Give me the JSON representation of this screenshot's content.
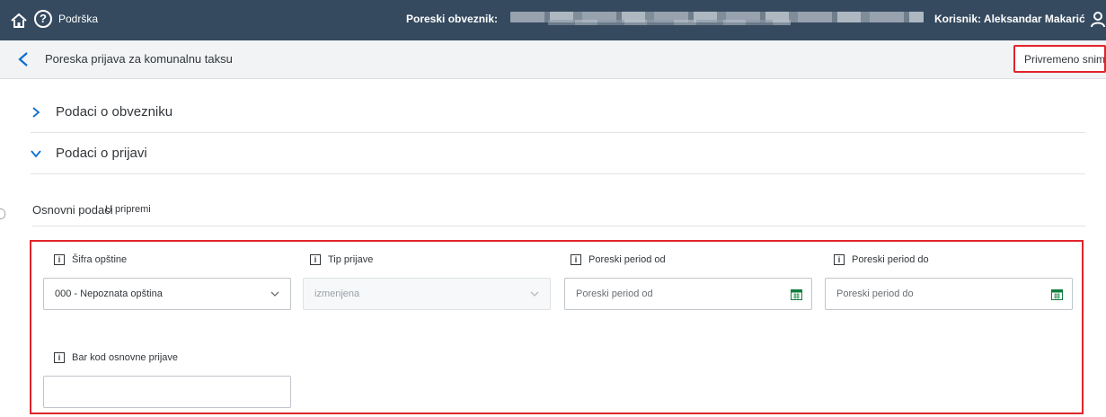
{
  "shell": {
    "support_label": "Podrška",
    "taxpayer_label": "Poreski obveznik:",
    "user_label": "Korisnik: Aleksandar Makarić",
    "icons": [
      "home-icon",
      "help-icon",
      "user-icon"
    ]
  },
  "header": {
    "title": "Poreska prijava za komunalnu taksu",
    "save_draft_label": "Privremeno snimi"
  },
  "sections": [
    {
      "label": "Podaci o obvezniku",
      "expanded": false
    },
    {
      "label": "Podaci o prijavi",
      "expanded": true
    }
  ],
  "basic": {
    "title": "Osnovni podaci",
    "status": "U pripremi"
  },
  "form": {
    "municipality_code": {
      "label": "Šifra opštine",
      "value": "000 - Nepoznata opština"
    },
    "filing_type": {
      "label": "Tip prijave",
      "value": "izmenjena"
    },
    "period_from": {
      "label": "Poreski period od",
      "placeholder": "Poreski period od"
    },
    "period_to": {
      "label": "Poreski period do",
      "placeholder": "Poreski period do"
    },
    "barcode": {
      "label": "Bar kod osnovne prijave",
      "value": ""
    }
  },
  "colors": {
    "shell_bg": "#354a5f",
    "highlight": "#e0242a",
    "accent": "#0a6ed1",
    "calendar": "#107e3e"
  }
}
